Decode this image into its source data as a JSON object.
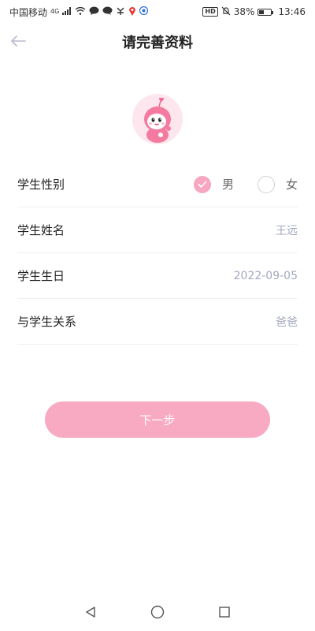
{
  "status_bar": {
    "carrier": "中国移动",
    "network": "4G",
    "battery": "38%",
    "battery_level": 0.38,
    "time": "13:46",
    "hd_badge": "HD"
  },
  "header": {
    "title": "请完善资料",
    "back_icon": "arrow-left-icon"
  },
  "avatar": {
    "icon": "pink-mascot-avatar"
  },
  "form": {
    "gender": {
      "label": "学生性别",
      "options": [
        "男",
        "女"
      ],
      "selected": "男"
    },
    "name": {
      "label": "学生姓名",
      "value": "王远"
    },
    "birthday": {
      "label": "学生生日",
      "value": "2022-09-05"
    },
    "relation": {
      "label": "与学生关系",
      "value": "爸爸"
    }
  },
  "next_button": {
    "label": "下一步"
  },
  "colors": {
    "accent": "#f7aac2",
    "value_text": "#a3a8bf",
    "avatar_bg": "#fde6ee"
  }
}
